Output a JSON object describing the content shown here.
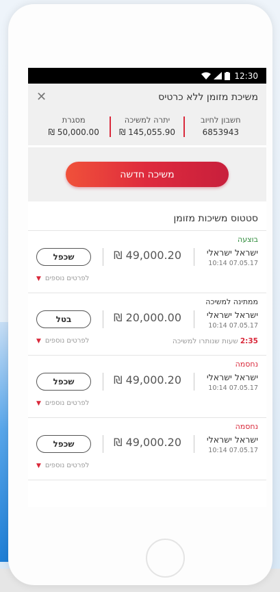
{
  "status_bar": {
    "time": "12:30",
    "icons": [
      "wifi-icon",
      "signal-icon",
      "battery-icon"
    ]
  },
  "header": {
    "title": "משיכת מזומן ללא כרטיס",
    "close_icon": "close-icon"
  },
  "summary": [
    {
      "label": "חשבון לחיוב",
      "value": "6853943"
    },
    {
      "label": "יתרה למשיכה",
      "value": "₪ 145,055.90"
    },
    {
      "label": "מסגרת",
      "value": "₪ 50,000.00"
    }
  ],
  "new_withdrawal_button": "משיכה חדשה",
  "section_title": "סטטוס משיכות מזומן",
  "withdrawals": [
    {
      "status": "בוצעה",
      "status_color": "#2e8b3a",
      "name": "ישראל ישראלי",
      "datetime": "10:14  07.05.17",
      "amount": "₪ 49,000.20",
      "action": "שכפל",
      "more": "לפרטים נוספים"
    },
    {
      "status": "ממתינה למשיכה",
      "status_color": "#333333",
      "name": "ישראל ישראלי",
      "datetime": "10:14  07.05.17",
      "amount": "₪ 20,000.00",
      "action": "בטל",
      "more": "לפרטים נוספים",
      "remaining_time": "2:35",
      "remaining_label": "שעות שנותרו למשיכה"
    },
    {
      "status": "נחסמה",
      "status_color": "#d9283a",
      "name": "ישראל ישראלי",
      "datetime": "10:14  07.05.17",
      "amount": "₪ 49,000.20",
      "action": "שכפל",
      "more": "לפרטים נוספים"
    },
    {
      "status": "נחסמה",
      "status_color": "#d9283a",
      "name": "ישראל ישראלי",
      "datetime": "10:14  07.05.17",
      "amount": "₪ 49,000.20",
      "action": "שכפל",
      "more": "לפרטים נוספים"
    }
  ],
  "colors": {
    "accent": "#d9283a",
    "success": "#2e8b3a"
  }
}
